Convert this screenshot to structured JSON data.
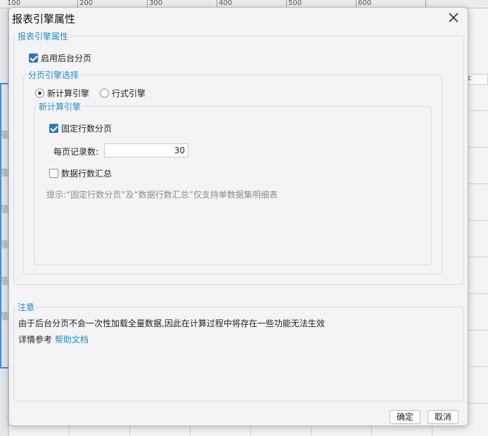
{
  "background": {
    "ruler_labels": [
      "100",
      "200",
      "300",
      "400",
      "500",
      "600"
    ],
    "partial_char": "集",
    "tag_text": "c"
  },
  "dialog": {
    "title": "报表引擎属性",
    "close_icon": "close-icon",
    "engine_props": {
      "legend": "报表引擎属性",
      "enable_backend_paging": {
        "label": "启用后台分页",
        "checked": true
      }
    },
    "paging_engine": {
      "legend": "分页引擎选择",
      "options": [
        {
          "label": "新计算引擎",
          "selected": true
        },
        {
          "label": "行式引擎",
          "selected": false
        }
      ]
    },
    "new_engine": {
      "legend": "新计算引擎",
      "fixed_rows": {
        "label": "固定行数分页",
        "checked": true
      },
      "records_per_page": {
        "label": "每页记录数:",
        "value": "30"
      },
      "row_summary": {
        "label": "数据行数汇总",
        "checked": false
      },
      "hint": "提示:“固定行数分页”及“数据行数汇总”仅支持单数据集明细表"
    },
    "note": {
      "legend": "注意",
      "line1": "由于后台分页不会一次性加载全量数据,因此在计算过程中将存在一些功能无法生效",
      "line2_prefix": "详情参考",
      "line2_link": "帮助文档"
    },
    "buttons": {
      "ok": "确定",
      "cancel": "取消"
    }
  },
  "colors": {
    "accent": "#1e8fc6",
    "checkbox": "#2b78c4"
  }
}
